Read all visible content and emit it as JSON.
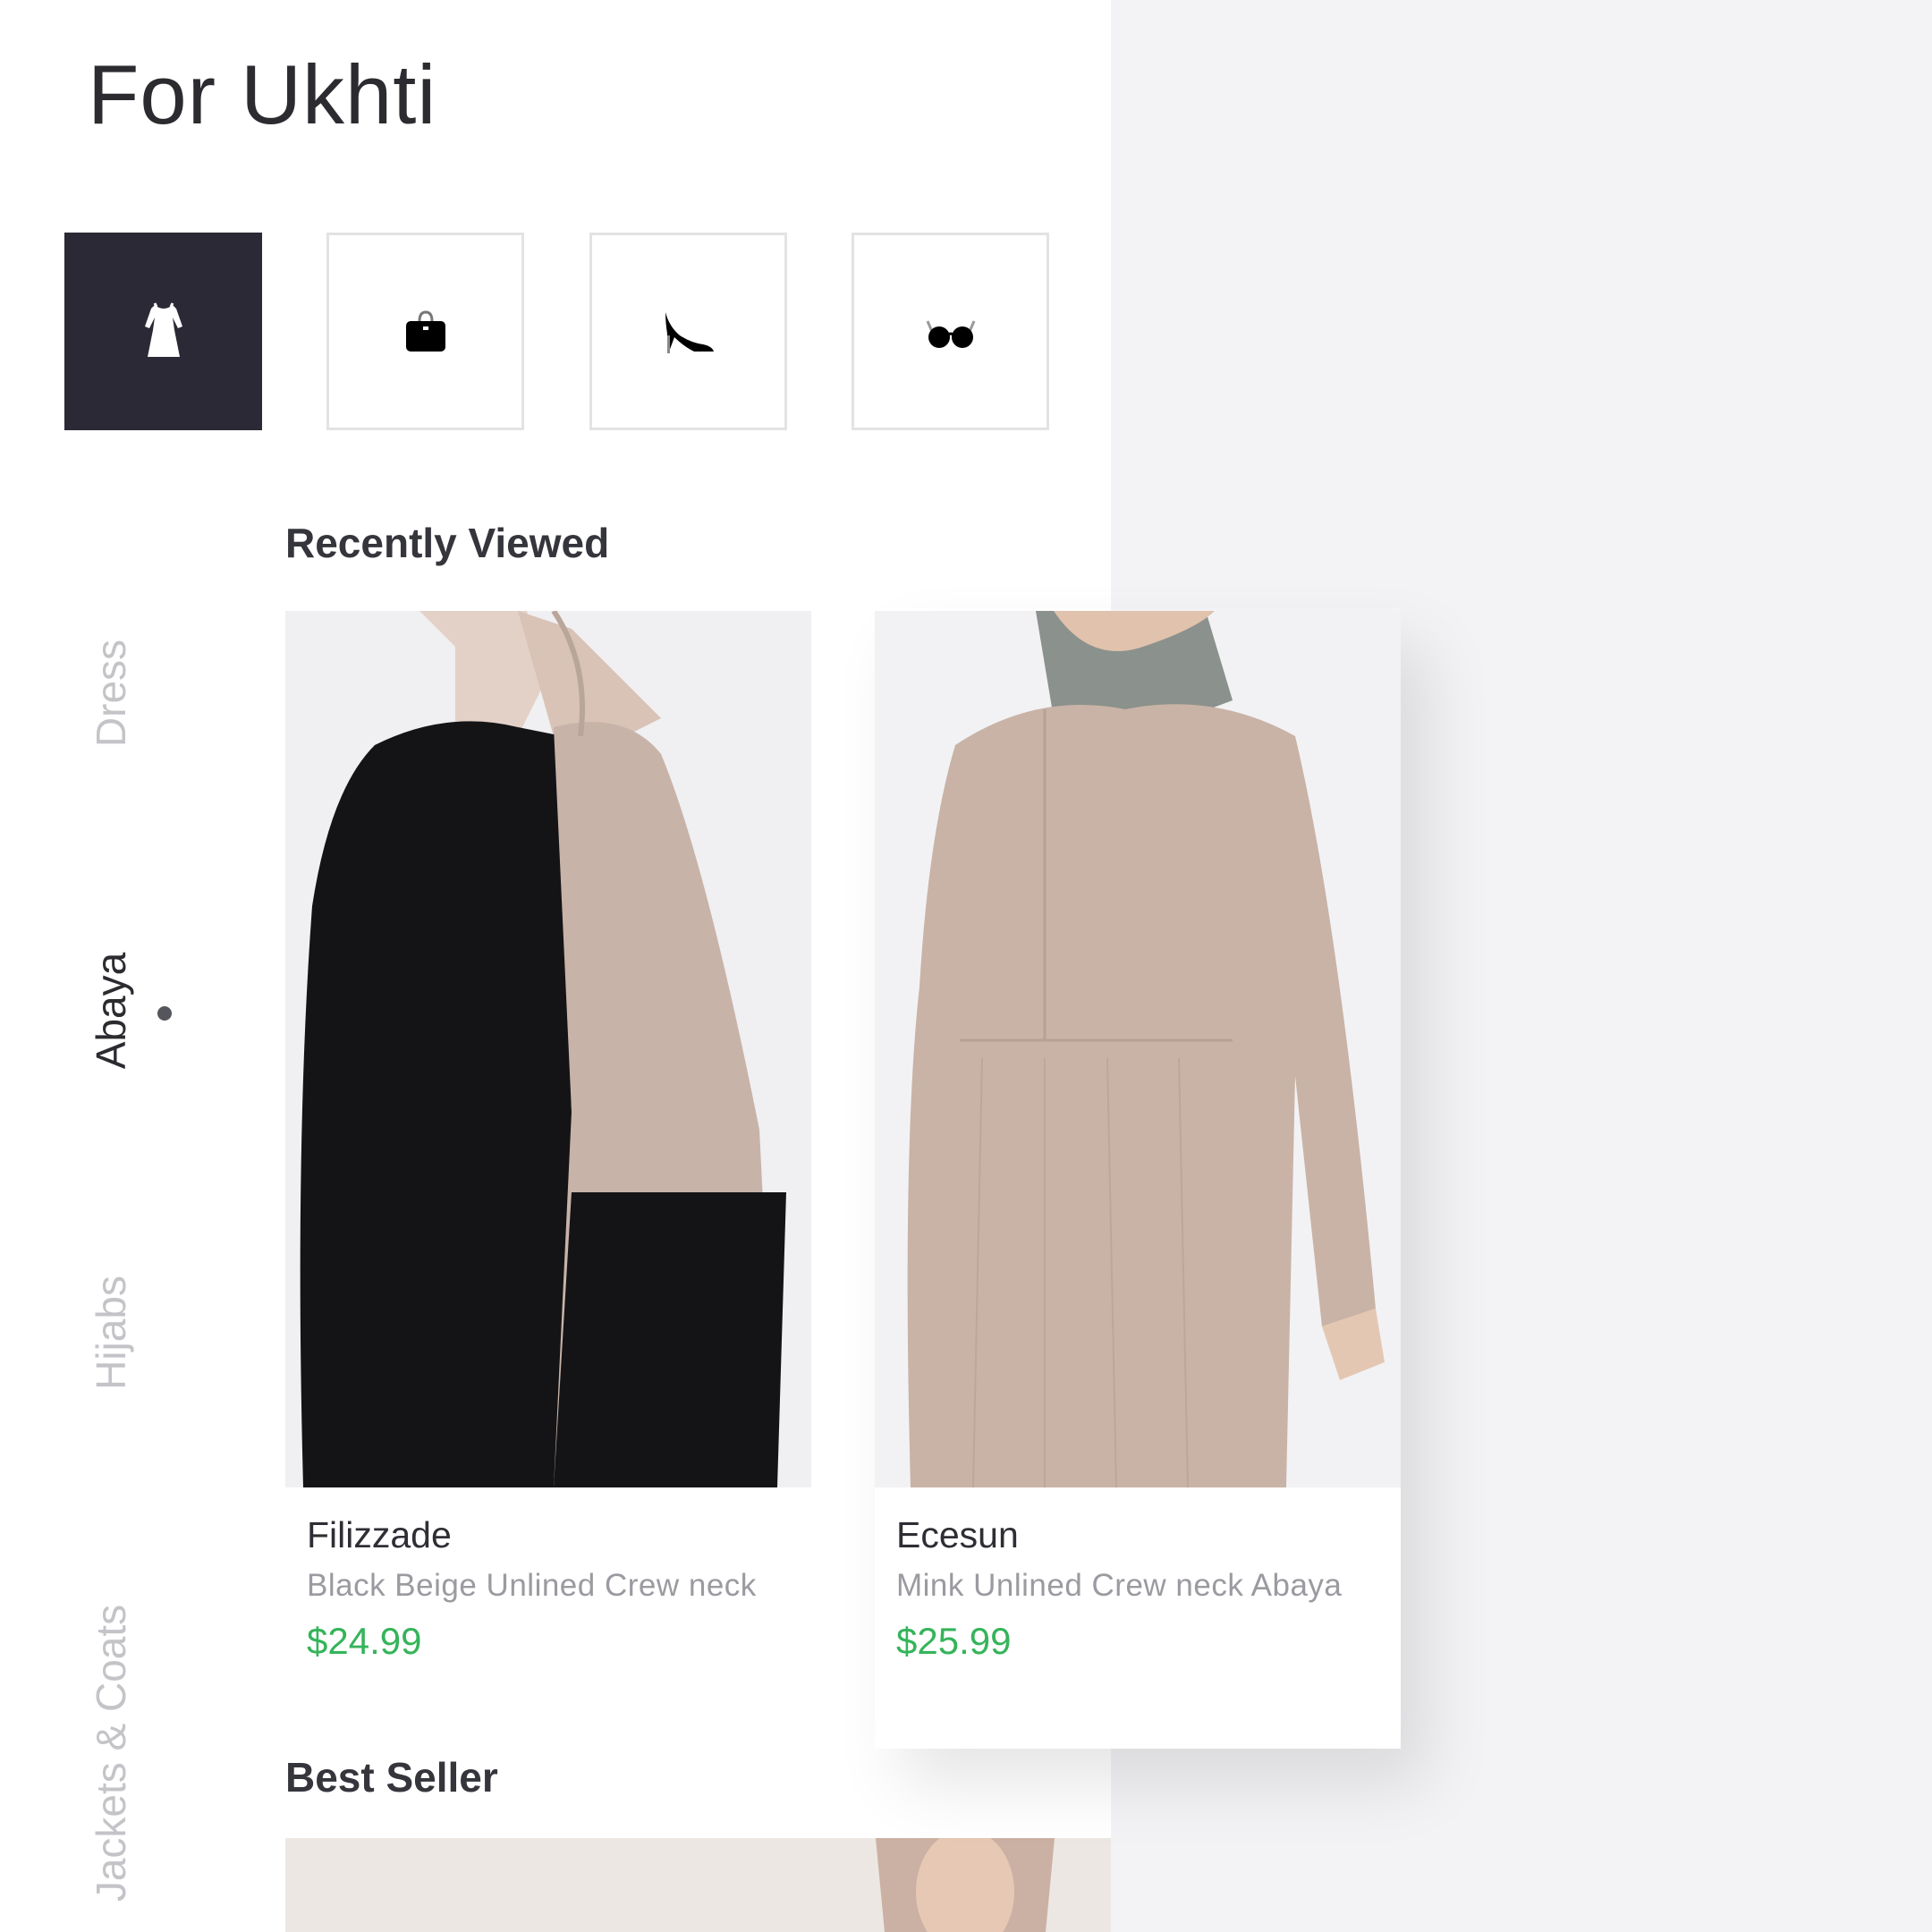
{
  "header": {
    "title": "For Ukhti"
  },
  "categories": [
    {
      "name": "dress",
      "icon": "dress-icon",
      "active": true
    },
    {
      "name": "bag",
      "icon": "handbag-icon",
      "active": false
    },
    {
      "name": "shoes",
      "icon": "high-heel-icon",
      "active": false
    },
    {
      "name": "glasses",
      "icon": "sunglasses-icon",
      "active": false
    }
  ],
  "side_nav": {
    "items": [
      {
        "label": "Dress",
        "active": false
      },
      {
        "label": "Abaya",
        "active": true
      },
      {
        "label": "Hijabs",
        "active": false
      },
      {
        "label": "Jackets & Coats",
        "active": false
      }
    ]
  },
  "recently_viewed": {
    "title": "Recently Viewed",
    "products": [
      {
        "brand": "Filizzade",
        "description": "Black Beige Unlined Crew neck",
        "price": "$24.99"
      },
      {
        "brand": "Ecesun",
        "description": "Mink Unlined Crew neck Abaya",
        "price": "$25.99"
      }
    ]
  },
  "best_seller": {
    "title": "Best Seller"
  },
  "colors": {
    "accent_dark": "#2a2935",
    "price_green": "#35b45a",
    "inactive_text": "#c4c4c8"
  }
}
